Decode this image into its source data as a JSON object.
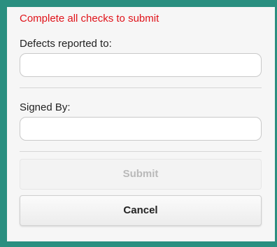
{
  "form": {
    "warning_text": "Complete all checks to submit",
    "defects_label": "Defects reported to:",
    "defects_value": "",
    "signed_label": "Signed By:",
    "signed_value": ""
  },
  "buttons": {
    "submit_label": "Submit",
    "cancel_label": "Cancel"
  },
  "colors": {
    "background": "#2a8f80",
    "warning": "#e0131a"
  }
}
